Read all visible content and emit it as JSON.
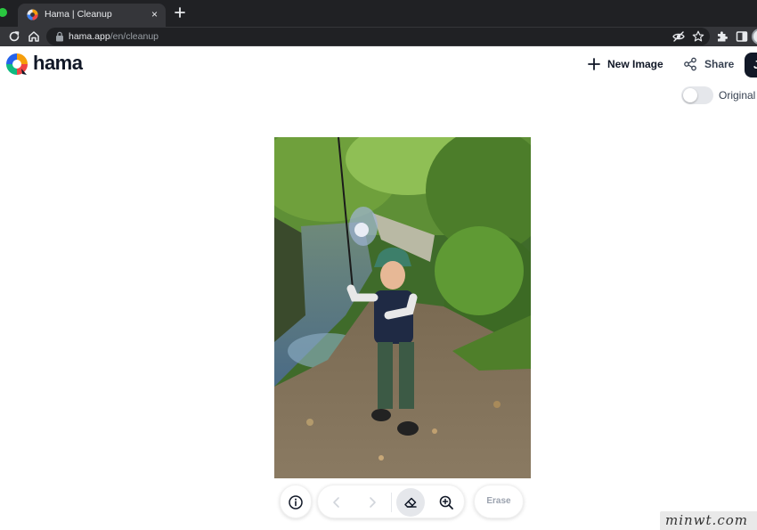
{
  "browser": {
    "tab_title": "Hama | Cleanup",
    "tab_close": "×",
    "url_host": "hama.app",
    "url_path": "/en/cleanup"
  },
  "header": {
    "brand": "hama",
    "new_image_label": "New Image",
    "share_label": "Share",
    "dark_button_label": "J",
    "original_label": "Original",
    "original_toggle_on": false
  },
  "toolbar": {
    "erase_label": "Erase"
  },
  "watermark": {
    "text": "minwt.com"
  },
  "colors": {
    "accent_dark": "#111827",
    "chrome_bg": "#202124",
    "brand_blue": "#2563eb"
  }
}
